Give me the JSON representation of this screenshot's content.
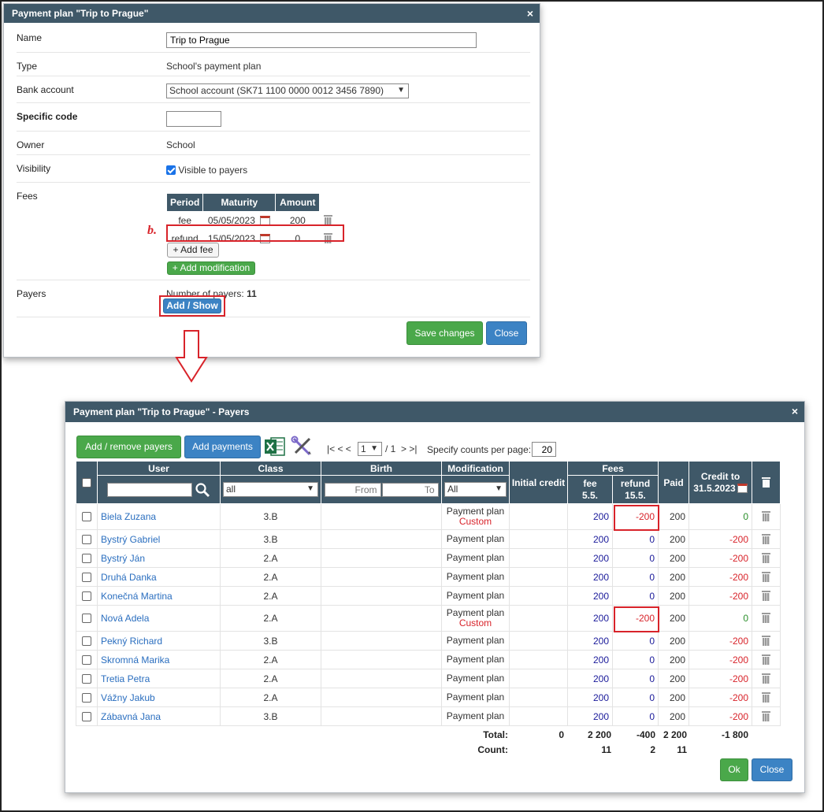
{
  "dialog1": {
    "title": "Payment plan \"Trip to Prague\"",
    "close_glyph": "×",
    "fields": {
      "name_label": "Name",
      "name_value": "Trip to Prague",
      "type_label": "Type",
      "type_value": "School's payment plan",
      "bank_label": "Bank account",
      "bank_value": "School account (SK71 1100 0000 0012 3456 7890)",
      "specific_label": "Specific code",
      "specific_value": "",
      "owner_label": "Owner",
      "owner_value": "School",
      "visibility_label": "Visibility",
      "visibility_value": "Visible to payers",
      "fees_label": "Fees",
      "payers_label": "Payers",
      "payers_count_label": "Number of payers:",
      "payers_count": "11"
    },
    "fees_table": {
      "headers": [
        "Period",
        "Maturity",
        "Amount"
      ],
      "rows": [
        {
          "period": "fee",
          "maturity": "05/05/2023",
          "amount": "200"
        },
        {
          "period": "refund",
          "maturity": "15/05/2023",
          "amount": "0"
        }
      ]
    },
    "annotation_label": "b.",
    "buttons": {
      "add_fee": "+ Add fee",
      "add_modification": "+ Add modification",
      "add_show": "Add / Show",
      "save": "Save changes",
      "close": "Close"
    }
  },
  "dialog2": {
    "title": "Payment plan \"Trip to Prague\" - Payers",
    "close_glyph": "×",
    "toolbar": {
      "add_remove": "Add / remove payers",
      "add_payments": "Add payments",
      "pager_first_prev": "|< < <",
      "page": "1",
      "page_sep": "/ 1",
      "pager_next_last": "> >|",
      "counts_label": "Specify counts per page:",
      "counts_value": "20"
    },
    "headers": {
      "user": "User",
      "class": "Class",
      "birth": "Birth",
      "modification": "Modification",
      "initial_credit": "Initial credit",
      "fees": "Fees",
      "fee_col": "fee",
      "fee_date": "5.5.",
      "refund_col": "refund",
      "refund_date": "15.5.",
      "paid": "Paid",
      "credit_to": "Credit to",
      "credit_date": "31.5.2023"
    },
    "filters": {
      "class": "all",
      "from_placeholder": "From",
      "to_placeholder": "To",
      "modification": "All"
    },
    "rows": [
      {
        "user": "Biela Zuzana",
        "class": "3.B",
        "mod": "Payment plan",
        "mod2": "Custom",
        "fee": "200",
        "refund": "-200",
        "paid": "200",
        "credit": "0"
      },
      {
        "user": "Bystrý Gabriel",
        "class": "3.B",
        "mod": "Payment plan",
        "mod2": "",
        "fee": "200",
        "refund": "0",
        "paid": "200",
        "credit": "-200"
      },
      {
        "user": "Bystrý Ján",
        "class": "2.A",
        "mod": "Payment plan",
        "mod2": "",
        "fee": "200",
        "refund": "0",
        "paid": "200",
        "credit": "-200"
      },
      {
        "user": "Druhá Danka",
        "class": "2.A",
        "mod": "Payment plan",
        "mod2": "",
        "fee": "200",
        "refund": "0",
        "paid": "200",
        "credit": "-200"
      },
      {
        "user": "Konečná Martina",
        "class": "2.A",
        "mod": "Payment plan",
        "mod2": "",
        "fee": "200",
        "refund": "0",
        "paid": "200",
        "credit": "-200"
      },
      {
        "user": "Nová Adela",
        "class": "2.A",
        "mod": "Payment plan",
        "mod2": "Custom",
        "fee": "200",
        "refund": "-200",
        "paid": "200",
        "credit": "0"
      },
      {
        "user": "Pekný Richard",
        "class": "3.B",
        "mod": "Payment plan",
        "mod2": "",
        "fee": "200",
        "refund": "0",
        "paid": "200",
        "credit": "-200"
      },
      {
        "user": "Skromná Marika",
        "class": "2.A",
        "mod": "Payment plan",
        "mod2": "",
        "fee": "200",
        "refund": "0",
        "paid": "200",
        "credit": "-200"
      },
      {
        "user": "Tretia Petra",
        "class": "2.A",
        "mod": "Payment plan",
        "mod2": "",
        "fee": "200",
        "refund": "0",
        "paid": "200",
        "credit": "-200"
      },
      {
        "user": "Vážny Jakub",
        "class": "2.A",
        "mod": "Payment plan",
        "mod2": "",
        "fee": "200",
        "refund": "0",
        "paid": "200",
        "credit": "-200"
      },
      {
        "user": "Zábavná Jana",
        "class": "3.B",
        "mod": "Payment plan",
        "mod2": "",
        "fee": "200",
        "refund": "0",
        "paid": "200",
        "credit": "-200"
      }
    ],
    "totals": {
      "total_label": "Total:",
      "count_label": "Count:",
      "initial": "0",
      "fee": "2 200",
      "refund": "-400",
      "paid": "2 200",
      "credit": "-1 800",
      "count_fee": "11",
      "count_refund": "2",
      "count_paid": "11"
    },
    "buttons": {
      "ok": "Ok",
      "close": "Close"
    }
  },
  "colors": {
    "header_bg": "#3f5868",
    "annotation_red": "#d8232a",
    "link_blue": "#2a6ebf",
    "btn_green": "#4aa84a",
    "btn_blue": "#3c83c4"
  }
}
